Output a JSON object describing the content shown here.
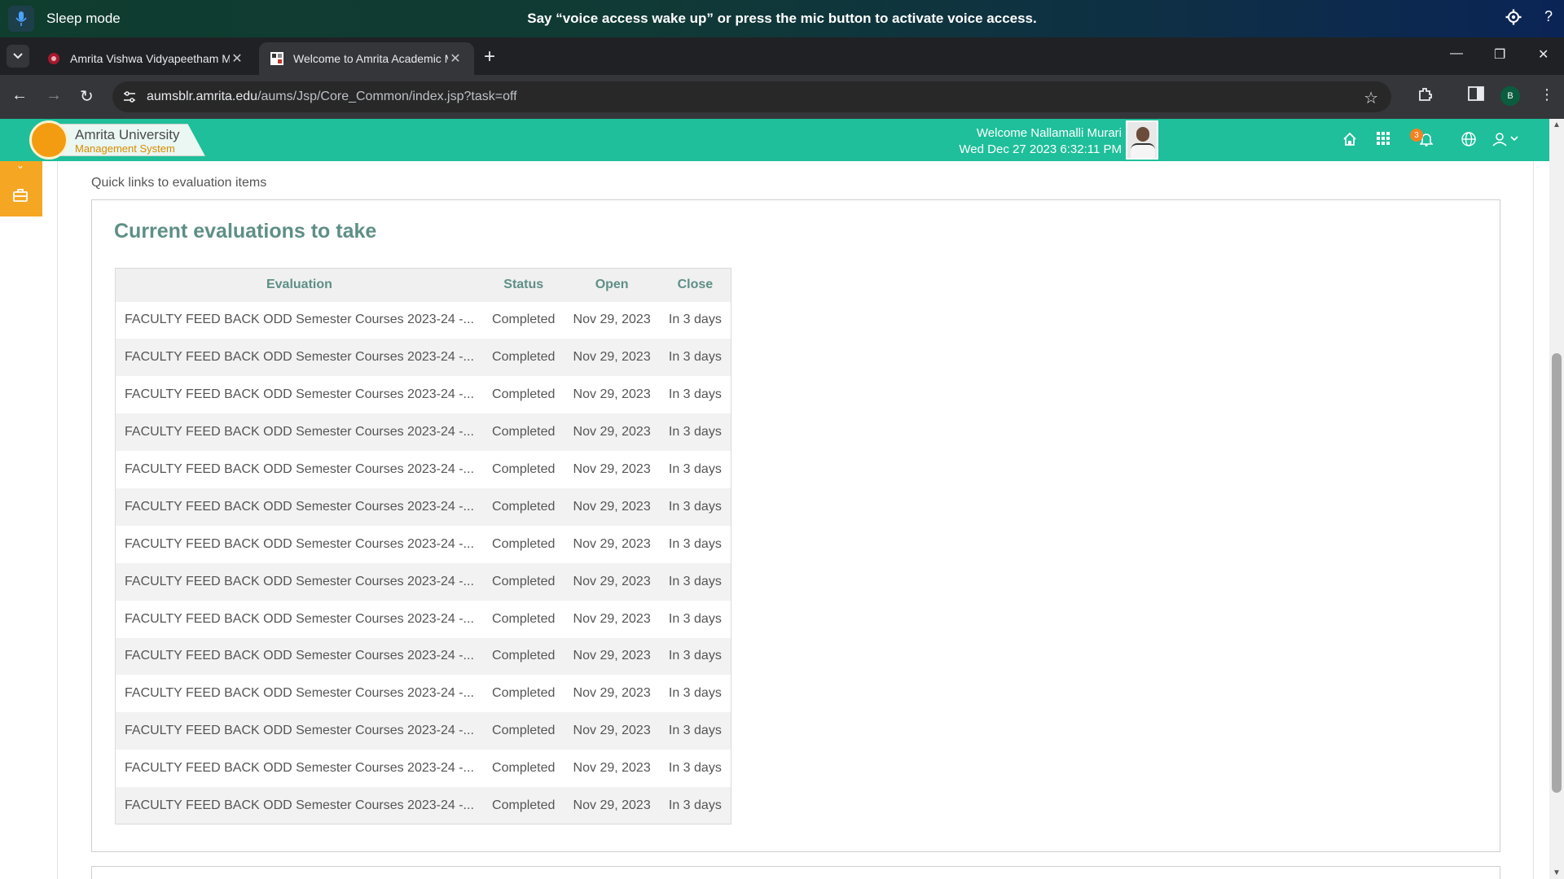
{
  "voice_access": {
    "mode_label": "Sleep mode",
    "message": "Say “voice access wake up” or press the mic button to activate voice access.",
    "help_label": "?"
  },
  "browser": {
    "tabs": [
      {
        "title": "Amrita Vishwa Vidyapeetham M",
        "active": false
      },
      {
        "title": "Welcome to Amrita Academic M",
        "active": true
      }
    ],
    "new_tab_label": "+",
    "url_host": "aumsblr.amrita.edu",
    "url_path": "/aums/Jsp/Core_Common/index.jsp?task=off",
    "profile_initial": "B",
    "accent_color": "#35363a"
  },
  "app": {
    "logo_line1": "Amrita University",
    "logo_line2": "Management System",
    "welcome_text": "Welcome Nallamalli Murari",
    "datetime": "Wed Dec 27 2023 6:32:11 PM",
    "notification_count": "3",
    "brand_color": "#1ebf9a"
  },
  "content": {
    "quick_links_label": "Quick links to evaluation items",
    "section_title": "Current evaluations to take",
    "columns": [
      "Evaluation",
      "Status",
      "Open",
      "Close"
    ],
    "rows": [
      {
        "evaluation": "FACULTY FEED BACK ODD Semester Courses 2023-24 -...",
        "status": "Completed",
        "open": "Nov 29, 2023",
        "close": "In 3 days"
      },
      {
        "evaluation": "FACULTY FEED BACK ODD Semester Courses 2023-24 -...",
        "status": "Completed",
        "open": "Nov 29, 2023",
        "close": "In 3 days"
      },
      {
        "evaluation": "FACULTY FEED BACK ODD Semester Courses 2023-24 -...",
        "status": "Completed",
        "open": "Nov 29, 2023",
        "close": "In 3 days"
      },
      {
        "evaluation": "FACULTY FEED BACK ODD Semester Courses 2023-24 -...",
        "status": "Completed",
        "open": "Nov 29, 2023",
        "close": "In 3 days"
      },
      {
        "evaluation": "FACULTY FEED BACK ODD Semester Courses 2023-24 -...",
        "status": "Completed",
        "open": "Nov 29, 2023",
        "close": "In 3 days"
      },
      {
        "evaluation": "FACULTY FEED BACK ODD Semester Courses 2023-24 -...",
        "status": "Completed",
        "open": "Nov 29, 2023",
        "close": "In 3 days"
      },
      {
        "evaluation": "FACULTY FEED BACK ODD Semester Courses 2023-24 -...",
        "status": "Completed",
        "open": "Nov 29, 2023",
        "close": "In 3 days"
      },
      {
        "evaluation": "FACULTY FEED BACK ODD Semester Courses 2023-24 -...",
        "status": "Completed",
        "open": "Nov 29, 2023",
        "close": "In 3 days"
      },
      {
        "evaluation": "FACULTY FEED BACK ODD Semester Courses 2023-24 -...",
        "status": "Completed",
        "open": "Nov 29, 2023",
        "close": "In 3 days"
      },
      {
        "evaluation": "FACULTY FEED BACK ODD Semester Courses 2023-24 -...",
        "status": "Completed",
        "open": "Nov 29, 2023",
        "close": "In 3 days"
      },
      {
        "evaluation": "FACULTY FEED BACK ODD Semester Courses 2023-24 -...",
        "status": "Completed",
        "open": "Nov 29, 2023",
        "close": "In 3 days"
      },
      {
        "evaluation": "FACULTY FEED BACK ODD Semester Courses 2023-24 -...",
        "status": "Completed",
        "open": "Nov 29, 2023",
        "close": "In 3 days"
      },
      {
        "evaluation": "FACULTY FEED BACK ODD Semester Courses 2023-24 -...",
        "status": "Completed",
        "open": "Nov 29, 2023",
        "close": "In 3 days"
      },
      {
        "evaluation": "FACULTY FEED BACK ODD Semester Courses 2023-24 -...",
        "status": "Completed",
        "open": "Nov 29, 2023",
        "close": "In 3 days"
      }
    ],
    "title_color": "#5e8f86"
  },
  "icons": {
    "mic": "mic-icon",
    "settings": "gear-icon",
    "help": "help-icon",
    "home": "home-icon",
    "apps": "grid-icon",
    "bell": "bell-icon",
    "globe": "globe-icon",
    "user": "user-icon",
    "briefcase": "briefcase-icon"
  }
}
